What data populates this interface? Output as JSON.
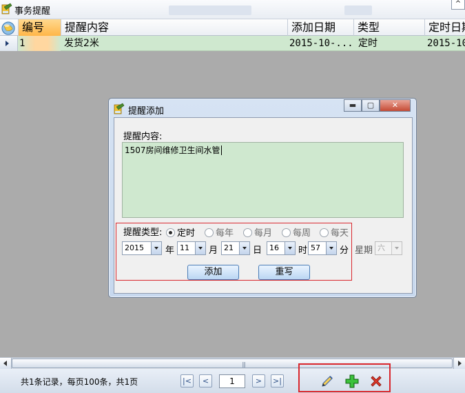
{
  "window": {
    "title": "事务提醒",
    "control": "^"
  },
  "grid": {
    "columns": [
      "编号",
      "提醒内容",
      "添加日期",
      "类型",
      "定时日期"
    ],
    "rows": [
      {
        "id": "1",
        "content": "发货2米",
        "add_date": "2015-10-...",
        "type": "定时",
        "timed_date": "2015-10"
      }
    ]
  },
  "dialog": {
    "title": "提醒添加",
    "content_label": "提醒内容:",
    "content_value": "1507房间维修卫生间水管",
    "type_label": "提醒类型:",
    "types": [
      "定时",
      "每年",
      "每月",
      "每周",
      "每天"
    ],
    "selected_type": "定时",
    "year": "2015",
    "year_unit": "年",
    "month": "11",
    "month_unit": "月",
    "day": "21",
    "day_unit": "日",
    "hour": "16",
    "hour_unit": "时",
    "minute": "57",
    "minute_unit": "分",
    "weekday_label": "星期",
    "weekday_value": "六",
    "add_button": "添加",
    "reset_button": "重写",
    "min_glyph": "▬",
    "max_glyph": "▢",
    "close_glyph": "✕"
  },
  "status": {
    "summary": "共1条记录，每页100条，共1页",
    "page": "1",
    "first": "|<",
    "prev": "<",
    "next": ">",
    "last": ">|"
  },
  "scrollbar": {
    "grip": "|||"
  }
}
